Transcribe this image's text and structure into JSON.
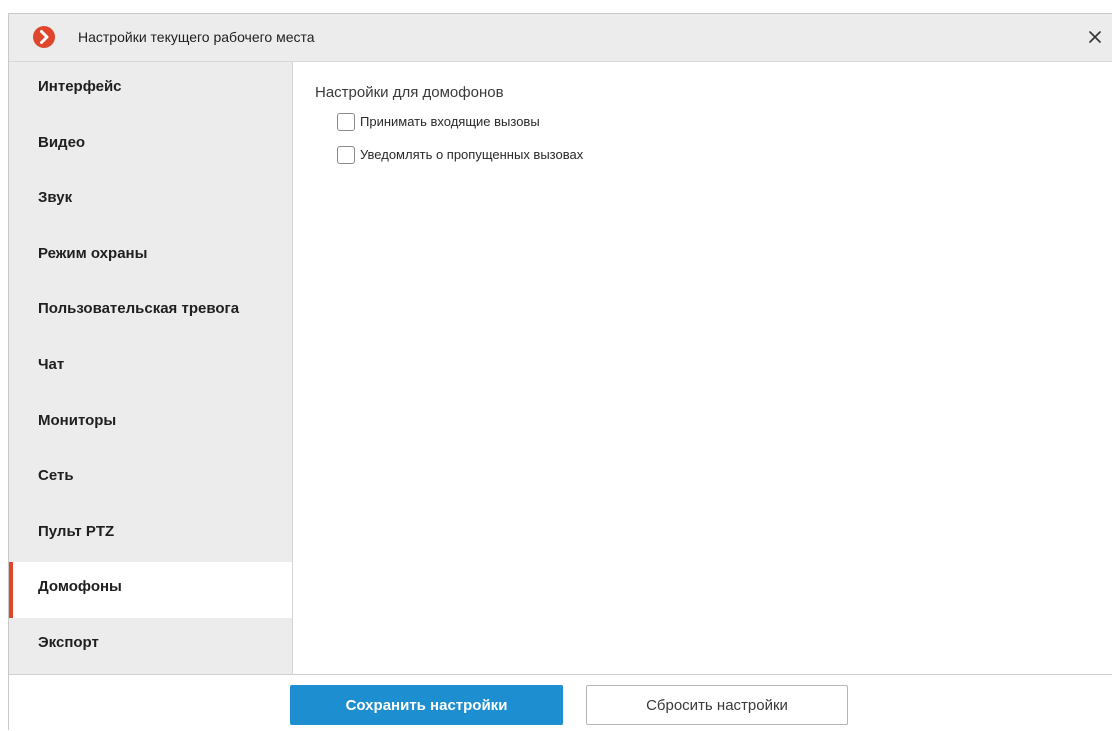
{
  "window": {
    "title": "Настройки текущего рабочего места",
    "logo_icon": "app-logo-icon",
    "close_icon": "close-icon",
    "accent_color": "#e0462c"
  },
  "sidebar": {
    "items": [
      {
        "label": "Интерфейс",
        "active": false
      },
      {
        "label": "Видео",
        "active": false
      },
      {
        "label": "Звук",
        "active": false
      },
      {
        "label": "Режим охраны",
        "active": false
      },
      {
        "label": "Пользовательская тревога",
        "active": false
      },
      {
        "label": "Чат",
        "active": false
      },
      {
        "label": "Мониторы",
        "active": false
      },
      {
        "label": "Сеть",
        "active": false
      },
      {
        "label": "Пульт PTZ",
        "active": false
      },
      {
        "label": "Домофоны",
        "active": true
      },
      {
        "label": "Экспорт",
        "active": false
      }
    ]
  },
  "main": {
    "section_title": "Настройки для домофонов",
    "options": [
      {
        "label": "Принимать входящие вызовы",
        "checked": false
      },
      {
        "label": "Уведомлять о пропущенных вызовах",
        "checked": false
      }
    ]
  },
  "footer": {
    "save_label": "Сохранить настройки",
    "reset_label": "Сбросить настройки",
    "primary_color": "#1d8fd1"
  }
}
